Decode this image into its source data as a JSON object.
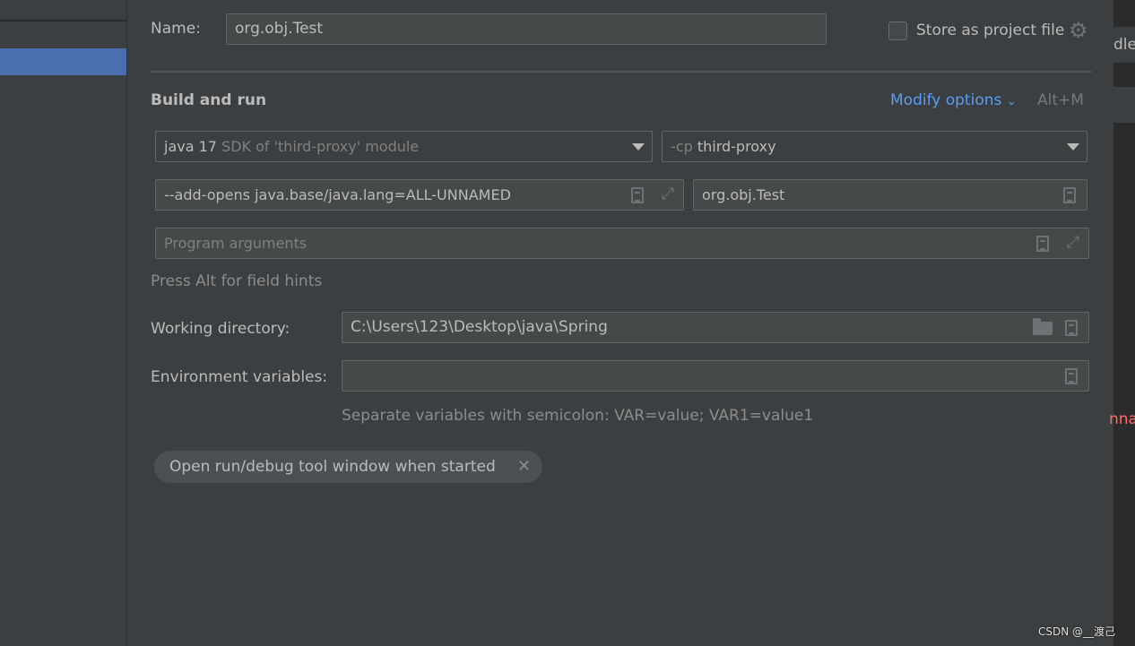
{
  "name": {
    "label": "Name:",
    "value": "org.obj.Test"
  },
  "store_project_file": {
    "label": "Store as project file",
    "checked": false
  },
  "section": {
    "title": "Build and run",
    "modify_options": "Modify options",
    "shortcut": "Alt+M"
  },
  "jre": {
    "value": "java 17",
    "hint": "SDK of 'third-proxy' module"
  },
  "classpath": {
    "prefix": "-cp",
    "value": "third-proxy"
  },
  "vm_options": {
    "value": "--add-opens java.base/java.lang=ALL-UNNAMED"
  },
  "main_class": {
    "value": "org.obj.Test"
  },
  "program_args": {
    "placeholder": "Program arguments"
  },
  "field_hint": "Press Alt for field hints",
  "working_dir": {
    "label": "Working directory:",
    "value": "C:\\Users\\123\\Desktop\\java\\Spring"
  },
  "env_vars": {
    "label": "Environment variables:",
    "value": "",
    "hint": "Separate variables with semicolon: VAR=value; VAR1=value1"
  },
  "tag": {
    "label": "Open run/debug tool window when started"
  },
  "background": {
    "right_tab_text": "dler",
    "right_red_text": "nna"
  },
  "watermark": "CSDN @__渡己",
  "colors": {
    "accent": "#589df6",
    "selection": "#4b6eaf",
    "bg": "#3c3f41",
    "field_bg": "#45494a"
  }
}
